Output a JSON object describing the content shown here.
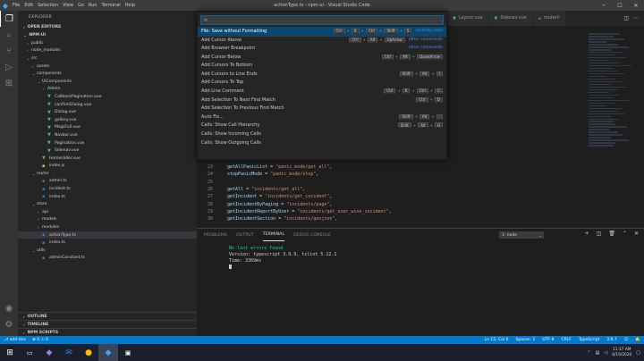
{
  "window": {
    "title": "actionType.ts - npm-ui - Visual Studio Code",
    "menu": [
      "File",
      "Edit",
      "Selection",
      "View",
      "Go",
      "Run",
      "Terminal",
      "Help"
    ]
  },
  "sidebar": {
    "header": "EXPLORER",
    "open_editors": "OPEN EDITORS",
    "root": "NPM-UI",
    "tree": [
      {
        "label": "public",
        "depth": 1,
        "type": "folder",
        "open": false
      },
      {
        "label": "node_modules",
        "depth": 1,
        "type": "folder",
        "open": false
      },
      {
        "label": "src",
        "depth": 1,
        "type": "folder",
        "open": true
      },
      {
        "label": "assets",
        "depth": 2,
        "type": "folder",
        "open": false
      },
      {
        "label": "components",
        "depth": 2,
        "type": "folder",
        "open": true
      },
      {
        "label": "UIComponents",
        "depth": 3,
        "type": "folder",
        "open": true
      },
      {
        "label": "Admin",
        "depth": 4,
        "type": "folder",
        "open": false
      },
      {
        "label": "CallbackPagination.vue",
        "depth": 4,
        "type": "vue"
      },
      {
        "label": "confirmDialog.vue",
        "depth": 4,
        "type": "vue"
      },
      {
        "label": "Dialog.vue",
        "depth": 4,
        "type": "vue"
      },
      {
        "label": "gallery.vue",
        "depth": 4,
        "type": "vue"
      },
      {
        "label": "MsgsFull.vue",
        "depth": 4,
        "type": "vue"
      },
      {
        "label": "Navbar.vue",
        "depth": 4,
        "type": "vue"
      },
      {
        "label": "Pagination.vue",
        "depth": 4,
        "type": "vue"
      },
      {
        "label": "Sidenav.vue",
        "depth": 4,
        "type": "vue"
      },
      {
        "label": "Homeslider.vue",
        "depth": 3,
        "type": "vue"
      },
      {
        "label": "index.js",
        "depth": 3,
        "type": "js"
      },
      {
        "label": "router",
        "depth": 2,
        "type": "folder",
        "open": true
      },
      {
        "label": "admin.ts",
        "depth": 3,
        "type": "ts"
      },
      {
        "label": "incident.ts",
        "depth": 3,
        "type": "ts"
      },
      {
        "label": "index.ts",
        "depth": 3,
        "type": "ts"
      },
      {
        "label": "store",
        "depth": 2,
        "type": "folder",
        "open": true
      },
      {
        "label": "api",
        "depth": 3,
        "type": "folder",
        "open": false
      },
      {
        "label": "models",
        "depth": 3,
        "type": "folder",
        "open": false
      },
      {
        "label": "modules",
        "depth": 3,
        "type": "folder",
        "open": false
      },
      {
        "label": "actionType.ts",
        "depth": 3,
        "type": "ts",
        "selected": true
      },
      {
        "label": "index.ts",
        "depth": 3,
        "type": "ts"
      },
      {
        "label": "utils",
        "depth": 2,
        "type": "folder",
        "open": true
      },
      {
        "label": "adminConstant.ts",
        "depth": 3,
        "type": "ts"
      }
    ],
    "bottom_sections": [
      "OUTLINE",
      "TIMELINE",
      "NPM SCRIPTS"
    ]
  },
  "tabs": [
    {
      "label": "Layout.vue",
      "active": false
    },
    {
      "label": "Sidenav.vue",
      "active": false
    },
    {
      "label": "router/i",
      "active": false
    }
  ],
  "palette": {
    "input": ">",
    "items": [
      {
        "label": "File: Save without Formatting",
        "keys": [
          "Ctrl",
          "K",
          "Ctrl",
          "Shift",
          "S"
        ],
        "hint": "recently used",
        "active": true
      },
      {
        "label": "Add Cursor Above",
        "keys": [
          "Ctrl",
          "Alt",
          "UpArrow"
        ],
        "hint": "other commands"
      },
      {
        "label": "Add Browser Breakpoint",
        "keys": [],
        "hint": "other commands"
      },
      {
        "label": "Add Cursor Below",
        "keys": [
          "Ctrl",
          "Alt",
          "DownArrow"
        ]
      },
      {
        "label": "Add Cursors To Bottom",
        "keys": []
      },
      {
        "label": "Add Cursors to Line Ends",
        "keys": [
          "Shift",
          "Alt",
          "I"
        ]
      },
      {
        "label": "Add Cursors To Top",
        "keys": []
      },
      {
        "label": "Add Line Comment",
        "keys": [
          "Ctrl",
          "K",
          "Ctrl",
          "C"
        ]
      },
      {
        "label": "Add Selection To Next Find Match",
        "keys": [
          "Ctrl",
          "D"
        ]
      },
      {
        "label": "Add Selection To Previous Find Match",
        "keys": []
      },
      {
        "label": "Auto Fix...",
        "keys": [
          "Shift",
          "Alt",
          "."
        ]
      },
      {
        "label": "Calls: Show Call Hierarchy",
        "keys": [
          "Shift",
          "Alt",
          "H"
        ]
      },
      {
        "label": "Calls: Show Incoming Calls",
        "keys": []
      },
      {
        "label": "Calls: Show Outgoing Calls",
        "keys": []
      }
    ]
  },
  "editor": {
    "lines": [
      {
        "num": "23",
        "prop": "getAllPanicList",
        "str": "\"panic_mode/get_all\""
      },
      {
        "num": "24",
        "prop": "stopPanicMode",
        "str": "\"panic_mode/stop\""
      },
      {
        "num": "25",
        "prop": "",
        "str": ""
      },
      {
        "num": "26",
        "prop": "getAll",
        "str": "\"incidents/get_all\""
      },
      {
        "num": "27",
        "prop": "getIncident",
        "str": "\"incidents/get_incident\""
      },
      {
        "num": "28",
        "prop": "getIncidentByPaging",
        "str": "\"incidents/page\""
      },
      {
        "num": "29",
        "prop": "getIncidentReportByUser",
        "str": "\"incidents/get_user_wise_incident\""
      },
      {
        "num": "30",
        "prop": "getIncidentSection",
        "str": "\"incidents/geojson\""
      }
    ]
  },
  "panel": {
    "tabs": [
      "PROBLEMS",
      "OUTPUT",
      "TERMINAL",
      "DEBUG CONSOLE"
    ],
    "active_tab": "TERMINAL",
    "terminal_select": "1: node",
    "terminal_lines": [
      {
        "text": "No lint errors found",
        "style": "green"
      },
      {
        "text": "Version: typescript 3.9.9, tslint 5.12.1",
        "style": "normal"
      },
      {
        "text": "Time: 3369ms",
        "style": "normal"
      }
    ]
  },
  "statusbar": {
    "left": [
      "⎇ add-dev",
      "⊗ 0 ⚠ 0"
    ],
    "right": [
      "Ln 12, Col 6",
      "Spaces: 2",
      "UTF-8",
      "CRLF",
      "TypeScript",
      "3.9.7",
      "☺",
      "🔔"
    ]
  },
  "taskbar": {
    "time": "11:17 AM",
    "date": "8/19/2020"
  }
}
